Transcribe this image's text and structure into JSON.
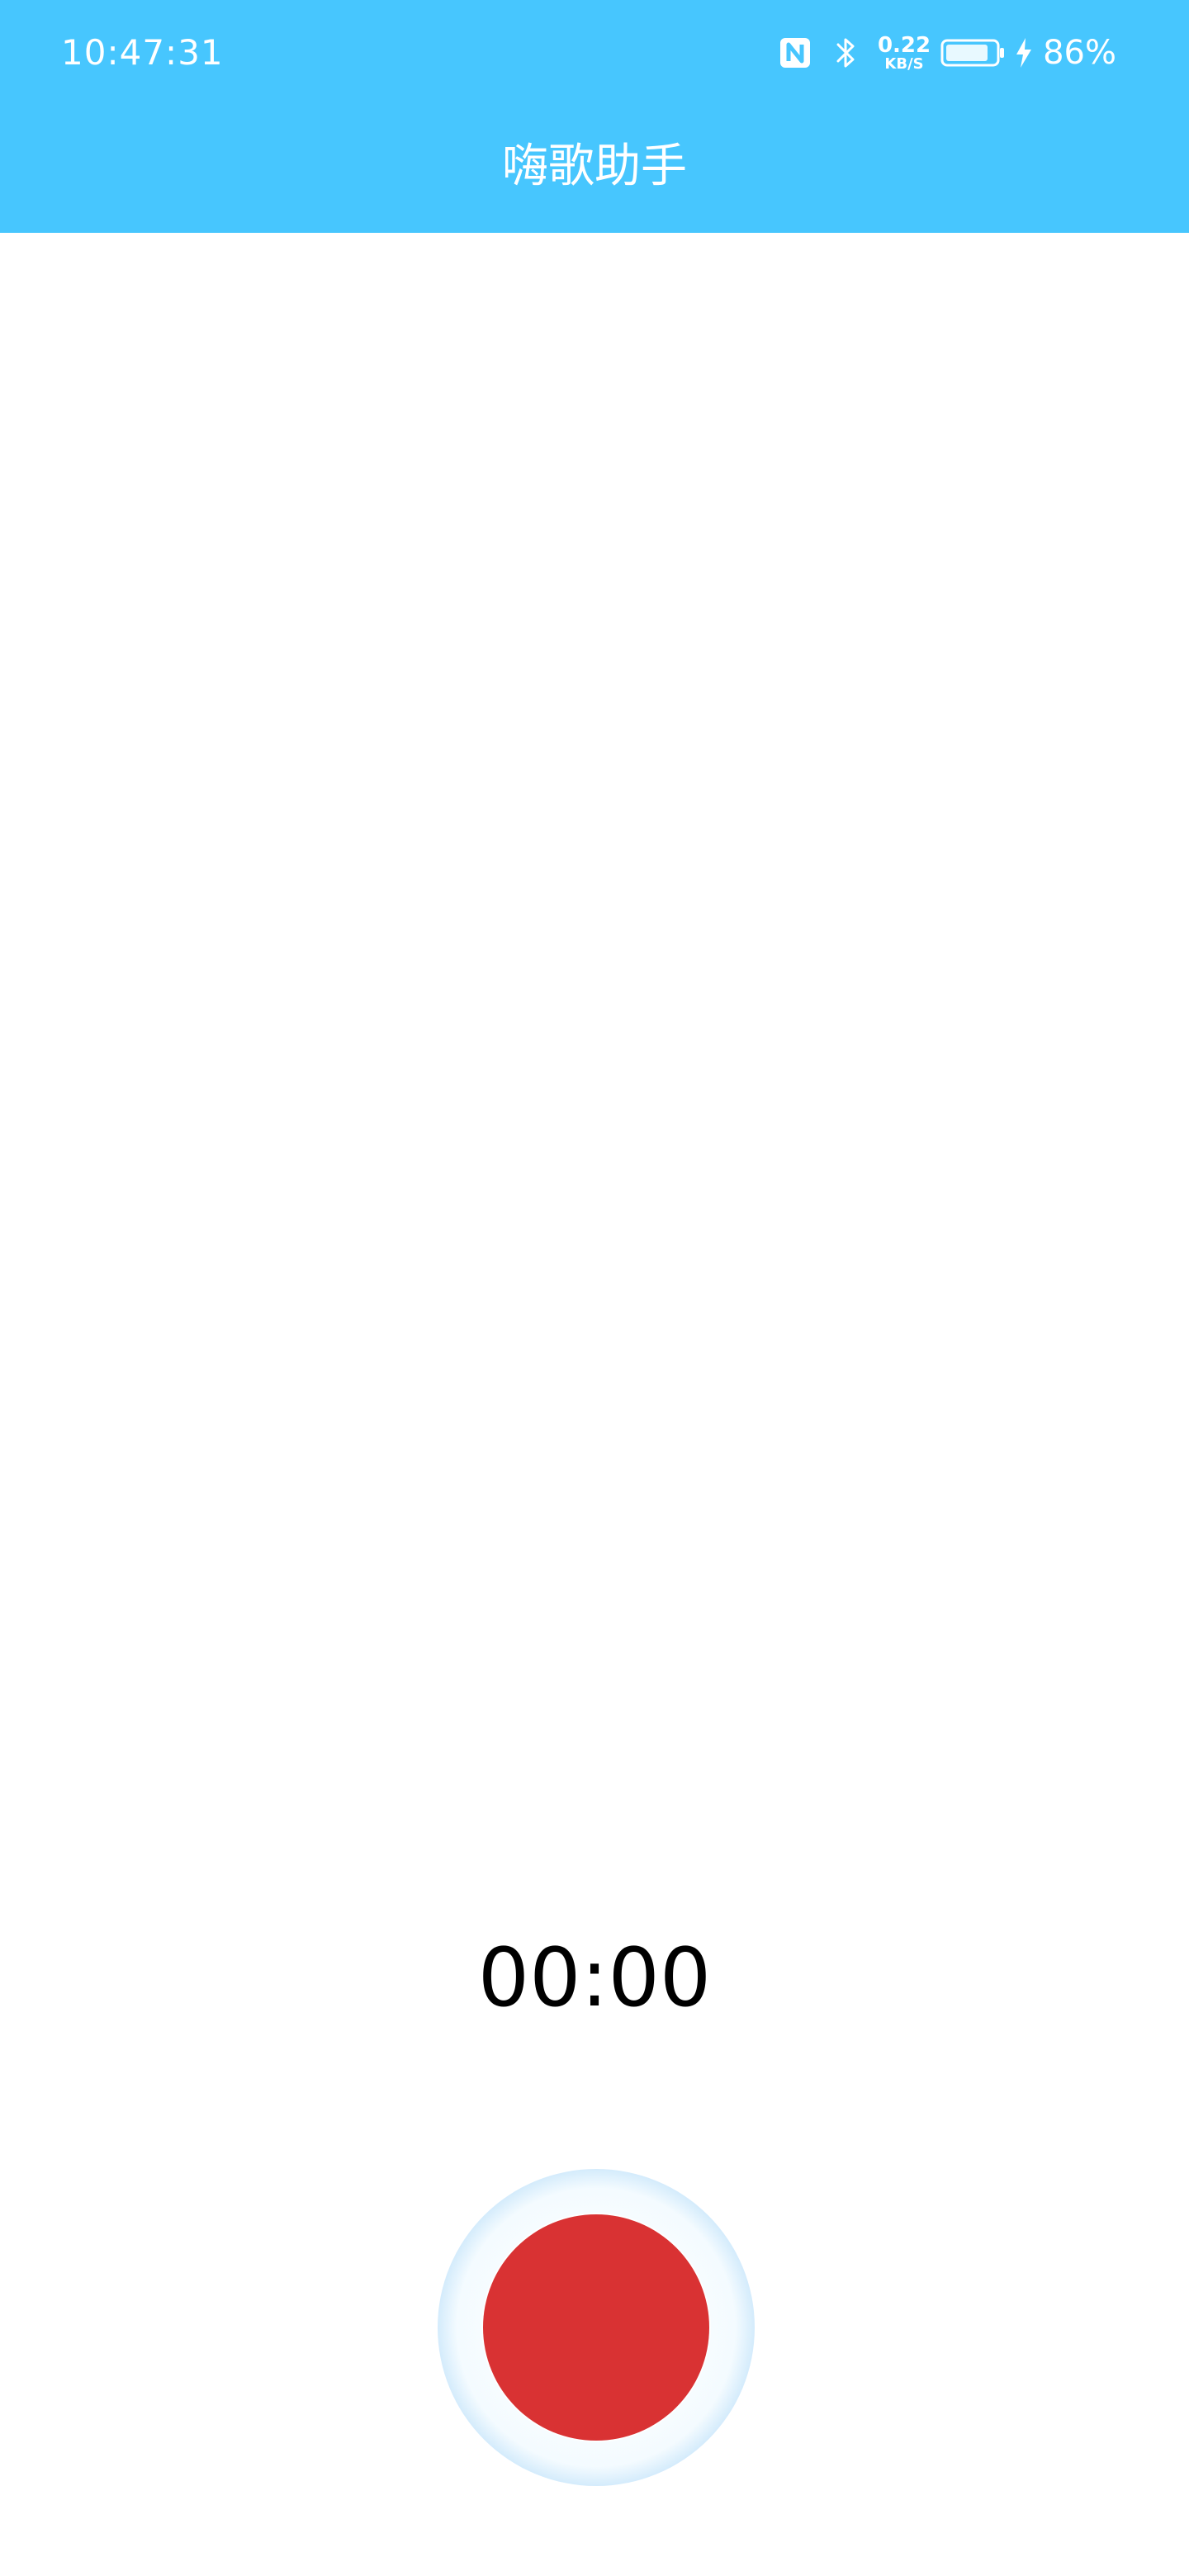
{
  "status_bar": {
    "time": "10:47:31",
    "net_speed_value": "0.22",
    "net_speed_unit": "KB/S",
    "battery_level": 0.86,
    "battery_percent": "86%",
    "icons": [
      "nfc-icon",
      "bluetooth-icon",
      "battery-icon",
      "charging-icon"
    ]
  },
  "header": {
    "title": "嗨歌助手",
    "background_color": "#47c6fe"
  },
  "recorder": {
    "timer": "00:00",
    "record_button_color": "#d93233",
    "ring_color": "#7dc0ee"
  }
}
